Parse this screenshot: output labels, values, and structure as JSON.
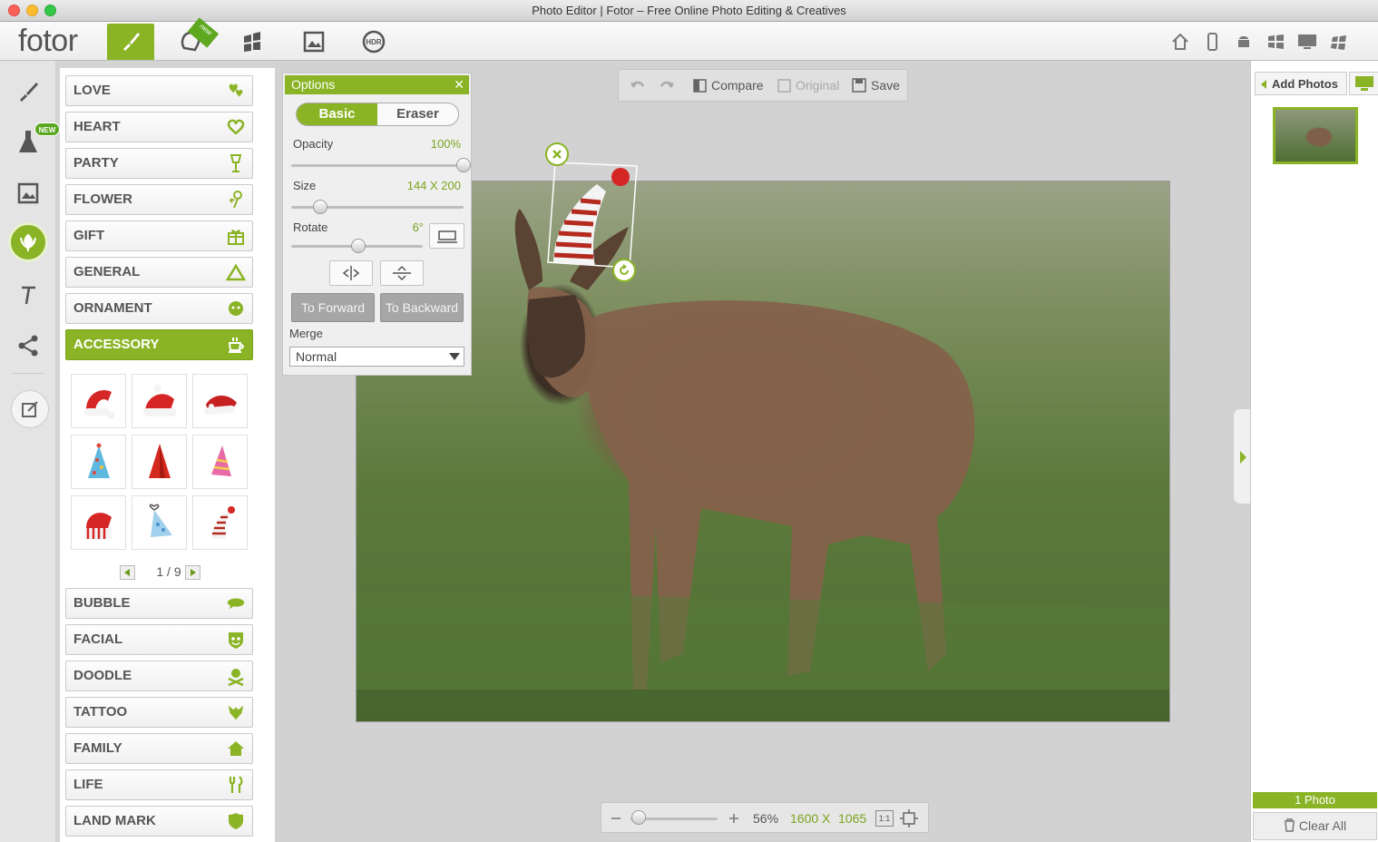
{
  "window": {
    "title": "Photo Editor | Fotor – Free Online Photo Editing & Creatives"
  },
  "app": {
    "logo": "fotor",
    "tab_new_badge": "new"
  },
  "rail": {
    "new_badge": "NEW"
  },
  "categories_top": [
    {
      "label": "LOVE",
      "icon": "hearts-icon"
    },
    {
      "label": "HEART",
      "icon": "heart-icon"
    },
    {
      "label": "PARTY",
      "icon": "glass-icon"
    },
    {
      "label": "FLOWER",
      "icon": "flower-icon"
    },
    {
      "label": "GIFT",
      "icon": "gift-icon"
    },
    {
      "label": "GENERAL",
      "icon": "triangle-icon"
    },
    {
      "label": "ORNAMENT",
      "icon": "ornament-icon"
    },
    {
      "label": "ACCESSORY",
      "icon": "cup-icon",
      "active": true
    }
  ],
  "categories_bottom": [
    {
      "label": "BUBBLE",
      "icon": "bubble-icon"
    },
    {
      "label": "FACIAL",
      "icon": "mask-icon"
    },
    {
      "label": "DOODLE",
      "icon": "skull-icon"
    },
    {
      "label": "TATTOO",
      "icon": "tattoo-icon"
    },
    {
      "label": "FAMILY",
      "icon": "house-icon"
    },
    {
      "label": "LIFE",
      "icon": "fork-knife-icon"
    },
    {
      "label": "LAND MARK",
      "icon": "shield-icon"
    }
  ],
  "pager": {
    "text": "1 / 9"
  },
  "edit_toolbar": {
    "compare": "Compare",
    "original": "Original",
    "save": "Save"
  },
  "options": {
    "title": "Options",
    "tab_basic": "Basic",
    "tab_eraser": "Eraser",
    "opacity_label": "Opacity",
    "opacity_value": "100%",
    "opacity_level": 1.0,
    "size_label": "Size",
    "size_value": "144 X 200",
    "size_level": 0.17,
    "rotate_label": "Rotate",
    "rotate_value": "6°",
    "rotate_level": 0.51,
    "to_forward": "To Forward",
    "to_backward": "To Backward",
    "merge_label": "Merge",
    "merge_value": "Normal"
  },
  "zoom": {
    "value": "56%",
    "width": "1600",
    "x": "X",
    "height": "1065",
    "one_to_one": "1:1",
    "level": 0.09
  },
  "right": {
    "add_photos": "Add Photos",
    "photo_count": "1 Photo",
    "clear_all": "Clear All"
  },
  "colors": {
    "accent": "#8ab425"
  }
}
